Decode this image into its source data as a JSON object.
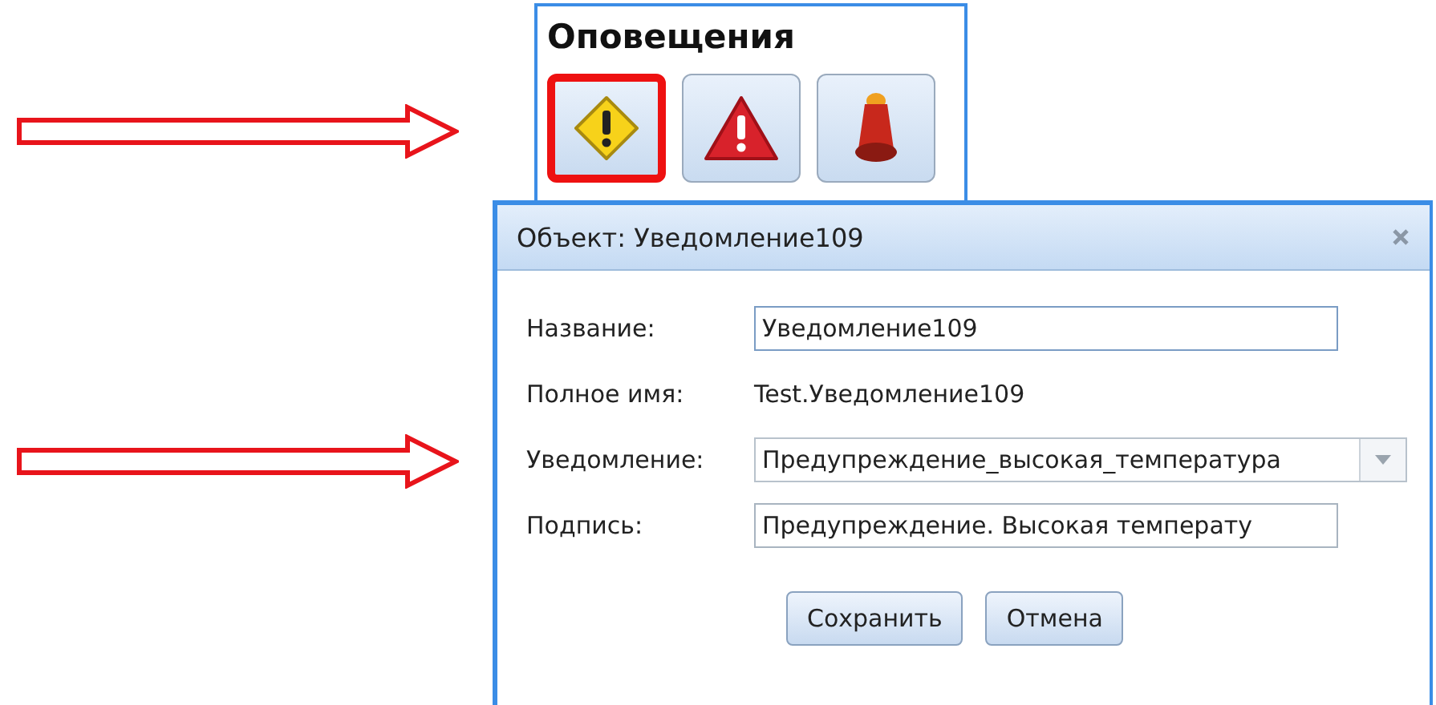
{
  "alerts_panel": {
    "title": "Оповещения",
    "buttons": [
      {
        "kind": "warning",
        "highlighted": true
      },
      {
        "kind": "error",
        "highlighted": false
      },
      {
        "kind": "beacon",
        "highlighted": false
      }
    ]
  },
  "dialog": {
    "title": "Объект: Уведомление109",
    "fields": [
      {
        "kind": "input",
        "label": "Название:",
        "value": "Уведомление109",
        "focused": true
      },
      {
        "kind": "text",
        "label": "Полное имя:",
        "value": "Test.Уведомление109"
      },
      {
        "kind": "select",
        "label": "Уведомление:",
        "value": "Предупреждение_высокая_температура"
      },
      {
        "kind": "input",
        "label": "Подпись:",
        "value": "Предупреждение. Высокая температу",
        "focused": false
      }
    ],
    "buttons": [
      "Сохранить",
      "Отмена"
    ]
  }
}
